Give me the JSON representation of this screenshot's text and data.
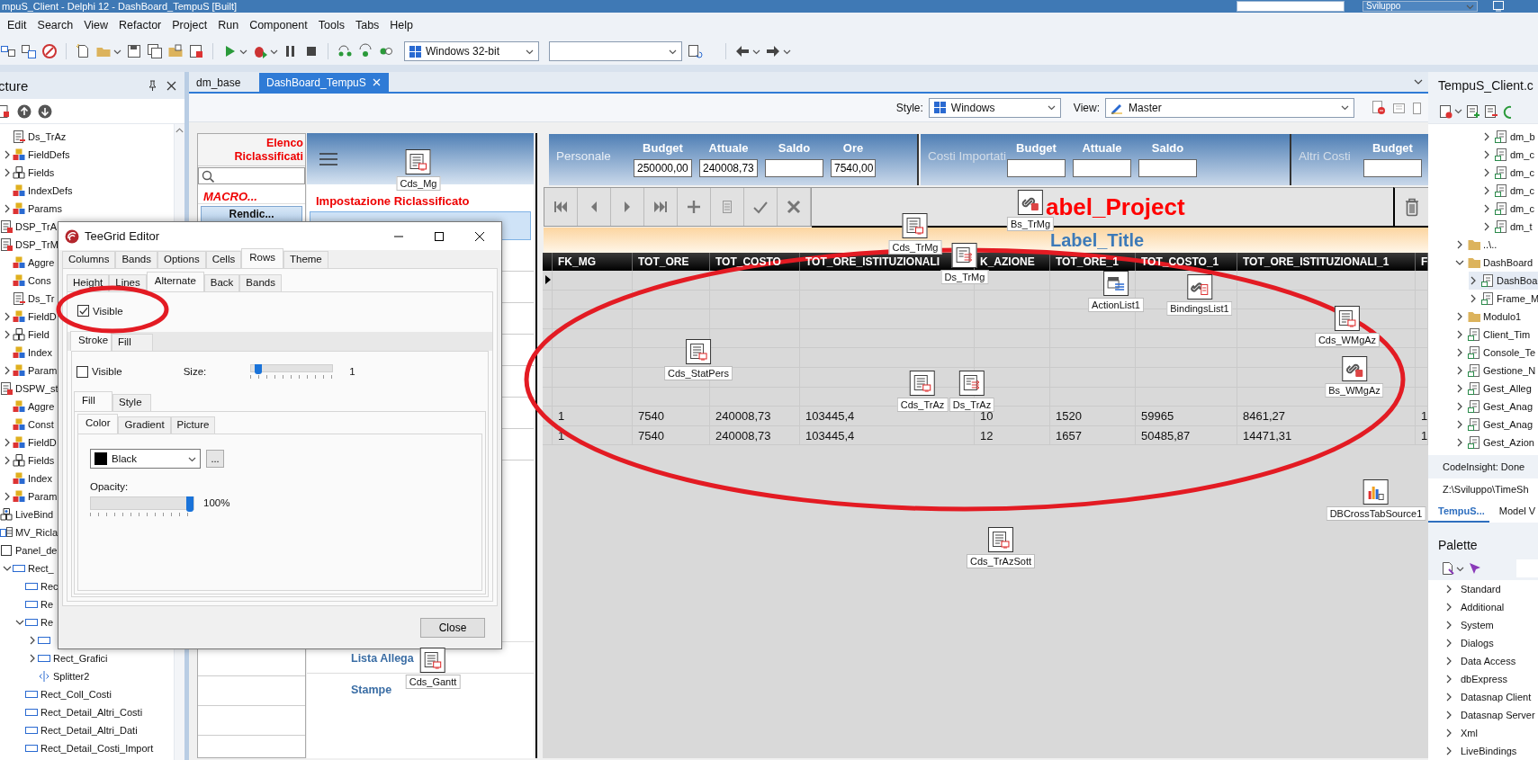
{
  "window": {
    "title": "mpuS_Client - Delphi 12 - DashBoard_TempuS [Built]",
    "profile": "Sviluppo"
  },
  "menu": [
    "Edit",
    "Search",
    "View",
    "Refactor",
    "Project",
    "Run",
    "Component",
    "Tools",
    "Tabs",
    "Help"
  ],
  "toolbar": {
    "platform": "Windows 32-bit"
  },
  "structure": {
    "title": "cture",
    "continued": [
      {
        "label": "Ds_TrAz",
        "kind": "dataset"
      },
      {
        "label": "FieldDefs",
        "kind": "fielddefs",
        "expanded": false
      },
      {
        "label": "Fields",
        "kind": "fields",
        "expanded": false
      },
      {
        "label": "IndexDefs",
        "kind": "fielddefs"
      },
      {
        "label": "Params",
        "kind": "fielddefs",
        "expanded": false
      }
    ],
    "items": [
      {
        "label": "DSP_TrA",
        "kind": "provider"
      },
      {
        "label": "DSP_TrM",
        "kind": "provider",
        "children": [
          {
            "label": "Aggre",
            "kind": "fielddefs"
          },
          {
            "label": "Cons",
            "kind": "fielddefs"
          },
          {
            "label": "Ds_Tr",
            "kind": "dataset"
          },
          {
            "label": "FieldD",
            "kind": "fielddefs",
            "expanded": false
          },
          {
            "label": "Field",
            "kind": "fields",
            "expanded": false
          },
          {
            "label": "Index",
            "kind": "fielddefs"
          },
          {
            "label": "Param",
            "kind": "fielddefs",
            "expanded": false
          }
        ]
      },
      {
        "label": "DSPW_st",
        "kind": "provider",
        "children": [
          {
            "label": "Aggre",
            "kind": "fielddefs"
          },
          {
            "label": "Const",
            "kind": "fielddefs"
          },
          {
            "label": "FieldD",
            "kind": "fielddefs",
            "expanded": false
          },
          {
            "label": "Fields",
            "kind": "fields",
            "expanded": false
          },
          {
            "label": "Index",
            "kind": "fielddefs"
          },
          {
            "label": "Param",
            "kind": "fielddefs",
            "expanded": false
          }
        ]
      },
      {
        "label": "LiveBind",
        "kind": "livebindings"
      },
      {
        "label": "MV_Ricla",
        "kind": "view"
      },
      {
        "label": "Panel_de",
        "kind": "panel",
        "children": [
          {
            "label": "Rect_",
            "kind": "rect",
            "expanded": true,
            "children": [
              {
                "label": "Rec",
                "kind": "rect"
              },
              {
                "label": "Re",
                "kind": "rect"
              },
              {
                "label": "Re",
                "kind": "rect",
                "expanded": true,
                "children": [
                  {
                    "kind": "rect",
                    "expanded": false
                  },
                  {
                    "label": "Rect_Grafici",
                    "kind": "rect",
                    "expanded": false
                  },
                  {
                    "label": "Splitter2",
                    "kind": "splitter"
                  }
                ]
              },
              {
                "label": "Rect_Coll_Costi",
                "kind": "rect"
              },
              {
                "label": "Rect_Detail_Altri_Costi",
                "kind": "rect"
              },
              {
                "label": "Rect_Detail_Altri_Dati",
                "kind": "rect"
              },
              {
                "label": "Rect_Detail_Costi_Import",
                "kind": "rect"
              }
            ]
          }
        ]
      }
    ]
  },
  "editor_tabs": [
    {
      "label": "dm_base",
      "selected": false
    },
    {
      "label": "DashBoard_TempuS",
      "selected": true
    }
  ],
  "designer_bar": {
    "style_label": "Style:",
    "style": "Windows",
    "view_label": "View:",
    "view": "Master"
  },
  "form": {
    "list_panel": {
      "title": "Elenco Riclassificati",
      "macro": "MACRO...",
      "button": "Rendic..."
    },
    "menu_panel": {
      "title": "Impostazione Riclassificato",
      "items": [
        "Lista Allega",
        "Stampe"
      ]
    },
    "summary_panels": [
      {
        "title": "Personale",
        "fields": [
          {
            "label": "Budget",
            "value": "250000,00"
          },
          {
            "label": "Attuale",
            "value": "240008,73"
          },
          {
            "label": "Saldo"
          },
          {
            "label": "Ore",
            "value": "7540,00"
          }
        ]
      },
      {
        "title": "Costi Importati",
        "fields": [
          {
            "label": "Budget"
          },
          {
            "label": "Attuale"
          },
          {
            "label": "Saldo"
          }
        ]
      },
      {
        "title": "Altri Costi",
        "fields": [
          {
            "label": "Budget"
          }
        ]
      }
    ],
    "label_project": "abel_Project",
    "label_title": "Label_Title",
    "grid": {
      "columns": [
        "FK_MG",
        "TOT_ORE",
        "TOT_COSTO",
        "TOT_ORE_ISTITUZIONALI",
        "K_AZIONE",
        "TOT_ORE_1",
        "TOT_COSTO_1",
        "TOT_ORE_ISTITUZIONALI_1",
        "F"
      ],
      "rows": [
        [
          "1",
          "7540",
          "240008,73",
          "103445,4",
          "10",
          "1520",
          "59965",
          "8461,27",
          "1"
        ],
        [
          "1",
          "7540",
          "240008,73",
          "103445,4",
          "12",
          "1657",
          "50485,87",
          "14471,31",
          "1"
        ]
      ]
    }
  },
  "components": [
    {
      "label": "Cds_Mg",
      "kind": "clientdataset"
    },
    {
      "label": "Cds_TrMg",
      "kind": "clientdataset"
    },
    {
      "label": "Ds_TrMg",
      "kind": "dataset"
    },
    {
      "label": "Bs_TrMg",
      "kind": "bindsource"
    },
    {
      "label": "ActionList1",
      "kind": "actionlist"
    },
    {
      "label": "BindingsList1",
      "kind": "bindingslist"
    },
    {
      "label": "Cds_WMgAz",
      "kind": "clientdataset"
    },
    {
      "label": "Bs_WMgAz",
      "kind": "bindsource"
    },
    {
      "label": "Cds_StatPers",
      "kind": "clientdataset"
    },
    {
      "label": "Cds_TrAz",
      "kind": "clientdataset"
    },
    {
      "label": "Ds_TrAz",
      "kind": "dataset"
    },
    {
      "label": "DBCrossTabSource1",
      "kind": "crosstab"
    },
    {
      "label": "Cds_TrAzSott",
      "kind": "clientdataset"
    },
    {
      "label": "Cds_Gantt",
      "kind": "clientdataset"
    }
  ],
  "dialog": {
    "title": "TeeGrid Editor",
    "tabs": [
      {
        "label": "Columns",
        "selected": false
      },
      {
        "label": "Bands",
        "selected": false
      },
      {
        "label": "Options",
        "selected": false
      },
      {
        "label": "Cells",
        "selected": false
      },
      {
        "label": "Rows",
        "selected": true
      },
      {
        "label": "Theme",
        "selected": false
      }
    ],
    "subtabs": [
      {
        "label": "Height",
        "selected": false
      },
      {
        "label": "Lines",
        "selected": false
      },
      {
        "label": "Alternate",
        "selected": true
      },
      {
        "label": "Back",
        "selected": false
      },
      {
        "label": "Bands",
        "selected": false
      }
    ],
    "visible": {
      "label": "Visible",
      "checked": true
    },
    "stroke_tabs": [
      {
        "label": "Stroke",
        "selected": true
      },
      {
        "label": "Fill",
        "selected": false
      }
    ],
    "stroke_visible": {
      "label": "Visible",
      "checked": false
    },
    "size": {
      "label": "Size:",
      "level": 0.04,
      "reading": "1"
    },
    "fill_tabs": [
      {
        "label": "Fill",
        "selected": true
      },
      {
        "label": "Style",
        "selected": false
      }
    ],
    "color_tabs": [
      {
        "label": "Color",
        "selected": true
      },
      {
        "label": "Gradient",
        "selected": false
      },
      {
        "label": "Picture",
        "selected": false
      }
    ],
    "color": {
      "value": "Black",
      "color": "#000000"
    },
    "more": "...",
    "opacity": {
      "label": "Opacity:",
      "level": 1,
      "reading": "100%"
    },
    "close": "Close"
  },
  "project": {
    "title": "TempuS_Client.c",
    "continued": [
      {
        "label": "dm_b",
        "kind": "file",
        "expanded": false,
        "selected": false
      },
      {
        "label": "dm_c",
        "kind": "file",
        "expanded": false,
        "selected": false
      },
      {
        "label": "dm_c",
        "kind": "file",
        "expanded": false,
        "selected": false
      },
      {
        "label": "dm_c",
        "kind": "file",
        "expanded": false,
        "selected": false
      },
      {
        "label": "dm_c",
        "kind": "file",
        "expanded": false,
        "selected": false
      },
      {
        "label": "dm_t",
        "kind": "file",
        "expanded": false,
        "selected": false
      }
    ],
    "items": [
      {
        "label": "..\\..",
        "kind": "folder",
        "expanded": false,
        "selected": false
      },
      {
        "label": "DashBoard",
        "kind": "folder",
        "expanded": true,
        "selected": false,
        "children": [
          {
            "label": "DashBoa",
            "kind": "file",
            "expanded": false,
            "selected": true
          },
          {
            "label": "Frame_M",
            "kind": "file",
            "expanded": false,
            "selected": false
          }
        ]
      },
      {
        "label": "Modulo1",
        "kind": "folder",
        "expanded": false,
        "selected": false
      },
      {
        "label": "Client_Tim",
        "kind": "file",
        "expanded": false,
        "selected": false
      },
      {
        "label": "Console_Te",
        "kind": "file",
        "expanded": false,
        "selected": false
      },
      {
        "label": "Gestione_N",
        "kind": "file",
        "expanded": false,
        "selected": false
      },
      {
        "label": "Gest_Alleg",
        "kind": "file",
        "expanded": false,
        "selected": false
      },
      {
        "label": "Gest_Anag",
        "kind": "file",
        "expanded": false,
        "selected": false
      },
      {
        "label": "Gest_Anag",
        "kind": "file",
        "expanded": false,
        "selected": false
      },
      {
        "label": "Gest_Azion",
        "kind": "file",
        "expanded": false,
        "selected": false
      }
    ],
    "status": "CodeInsight: Done",
    "path": "Z:\\Sviluppo\\TimeSh",
    "tabs": [
      {
        "label": "TempuS...",
        "selected": true
      },
      {
        "label": "Model V",
        "selected": false
      }
    ]
  },
  "palette": {
    "title": "Palette",
    "categories": [
      "Standard",
      "Additional",
      "System",
      "Dialogs",
      "Data Access",
      "dbExpress",
      "Datasnap Client",
      "Datasnap Server",
      "Xml",
      "LiveBindings"
    ]
  },
  "annotations": [
    {
      "color": "#e31b23"
    },
    {
      "color": "#e31b23"
    }
  ]
}
